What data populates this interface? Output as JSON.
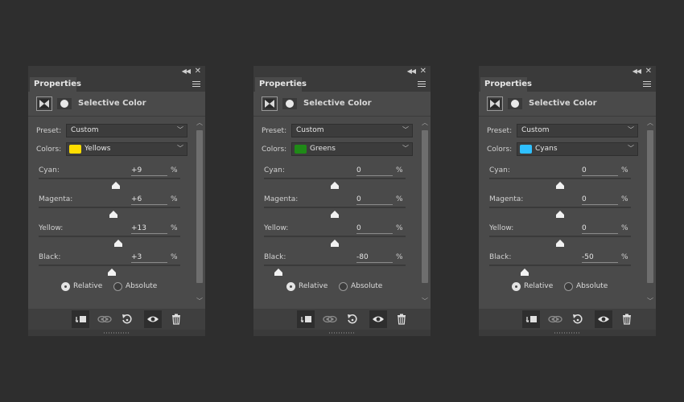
{
  "panels": [
    {
      "tab_label": "Properties",
      "header_title": "Selective Color",
      "preset_label": "Preset:",
      "preset_value": "Custom",
      "colors_label": "Colors:",
      "colors_value": "Yellows",
      "swatch_color": "#ffde00",
      "sliders": [
        {
          "label": "Cyan:",
          "value": "+9",
          "unit": "%",
          "fraction": 0.545
        },
        {
          "label": "Magenta:",
          "value": "+6",
          "unit": "%",
          "fraction": 0.53
        },
        {
          "label": "Yellow:",
          "value": "+13",
          "unit": "%",
          "fraction": 0.565
        },
        {
          "label": "Black:",
          "value": "+3",
          "unit": "%",
          "fraction": 0.515
        }
      ],
      "method": [
        {
          "label": "Relative",
          "checked": true
        },
        {
          "label": "Absolute",
          "checked": false
        }
      ]
    },
    {
      "tab_label": "Properties",
      "header_title": "Selective Color",
      "preset_label": "Preset:",
      "preset_value": "Custom",
      "colors_label": "Colors:",
      "colors_value": "Greens",
      "swatch_color": "#1f8a17",
      "sliders": [
        {
          "label": "Cyan:",
          "value": "0",
          "unit": "%",
          "fraction": 0.5
        },
        {
          "label": "Magenta:",
          "value": "0",
          "unit": "%",
          "fraction": 0.5
        },
        {
          "label": "Yellow:",
          "value": "0",
          "unit": "%",
          "fraction": 0.5
        },
        {
          "label": "Black:",
          "value": "-80",
          "unit": "%",
          "fraction": 0.1
        }
      ],
      "method": [
        {
          "label": "Relative",
          "checked": true
        },
        {
          "label": "Absolute",
          "checked": false
        }
      ]
    },
    {
      "tab_label": "Properties",
      "header_title": "Selective Color",
      "preset_label": "Preset:",
      "preset_value": "Custom",
      "colors_label": "Colors:",
      "colors_value": "Cyans",
      "swatch_color": "#2fc0ff",
      "sliders": [
        {
          "label": "Cyan:",
          "value": "0",
          "unit": "%",
          "fraction": 0.5
        },
        {
          "label": "Magenta:",
          "value": "0",
          "unit": "%",
          "fraction": 0.5
        },
        {
          "label": "Yellow:",
          "value": "0",
          "unit": "%",
          "fraction": 0.5
        },
        {
          "label": "Black:",
          "value": "-50",
          "unit": "%",
          "fraction": 0.25
        }
      ],
      "method": [
        {
          "label": "Relative",
          "checked": true
        },
        {
          "label": "Absolute",
          "checked": false
        }
      ]
    }
  ],
  "icons": {
    "titlebar": [
      "collapse-icon",
      "close-icon"
    ],
    "header": [
      "adjustment-layer-icon",
      "layer-mask-icon"
    ],
    "footer": [
      "clip-to-layer-icon",
      "view-previous-state-icon",
      "reset-icon",
      "visibility-eye-icon",
      "trash-icon"
    ]
  }
}
